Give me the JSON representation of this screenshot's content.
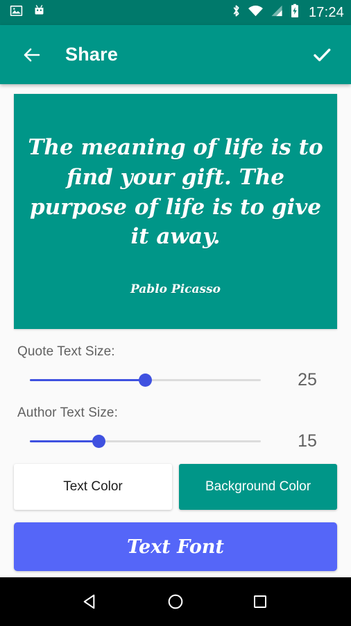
{
  "statusbar": {
    "time": "17:24",
    "icons": [
      "image-icon",
      "android-head-icon",
      "bluetooth-icon",
      "wifi-icon",
      "cell-signal-icon",
      "battery-charging-icon"
    ]
  },
  "appbar": {
    "back_icon": "back-arrow-icon",
    "title": "Share",
    "confirm_icon": "check-icon",
    "background_color": "#009688"
  },
  "preview": {
    "quote": "The meaning of life is to find your gift. The purpose of life is to give it away.",
    "author": "Pablo Picasso",
    "background_color": "#009688",
    "text_color": "#ffffff"
  },
  "controls": {
    "quote_size": {
      "label": "Quote Text Size:",
      "value": "25",
      "percent": 50
    },
    "author_size": {
      "label": "Author Text Size:",
      "value": "15",
      "percent": 30
    },
    "accent_color": "#3f51e0"
  },
  "buttons": {
    "text_color": "Text Color",
    "background_color": "Background Color",
    "text_font": "Text Font",
    "text_font_color": "#5566f8"
  },
  "navbar": {
    "back": "nav-back-icon",
    "home": "nav-home-icon",
    "recents": "nav-recents-icon"
  }
}
